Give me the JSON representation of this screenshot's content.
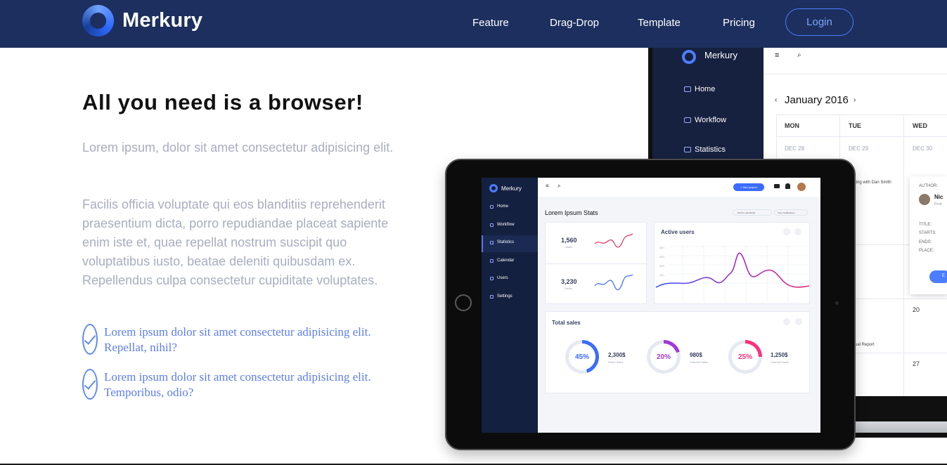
{
  "nav": {
    "brand": "Merkury",
    "links": [
      "Feature",
      "Drag-Drop",
      "Template",
      "Pricing"
    ],
    "login": "Login"
  },
  "hero": {
    "title": "All you need is a browser!",
    "p1": "Lorem ipsum, dolor sit amet consectetur adipisicing elit.",
    "p2": "Facilis officia voluptate qui eos blanditiis reprehenderit praesentium dicta, porro repudiandae placeat sapiente enim iste et, quae repellat nostrum suscipit quo voluptatibus iusto, beatae deleniti quibusdam ex. Repellendus culpa consectetur cupiditate voluptates.",
    "checks": [
      "Lorem ipsum dolor sit amet consectetur adipisicing elit. Repellat, nihil?",
      "Lorem ipsum dolor sit amet consectetur adipisicing elit. Temporibus, odio?"
    ]
  },
  "laptop": {
    "brand": "Merkury",
    "menu": [
      "Home",
      "Workflow",
      "Statistics"
    ],
    "month": "January 2016",
    "days": [
      "MON",
      "TUE",
      "WED"
    ],
    "dates": [
      "DEC 28",
      "DEC 29",
      "DEC 30"
    ],
    "event1": "ting with Dan Smith",
    "event2": "ual Report",
    "num1": "20",
    "num2": "27",
    "popup": {
      "author_label": "AUTHOR:",
      "author_name": "Nic",
      "author_role": "Prod",
      "title_label": "TITLE:",
      "starts_label": "STARTS:",
      "ends_label": "ENDS:",
      "place_label": "PLACE:",
      "button": "E"
    }
  },
  "tablet": {
    "brand": "Merkury",
    "menu": [
      "Home",
      "Workflow",
      "Statistics",
      "Calendar",
      "Users",
      "Settings"
    ],
    "add_project": "+ Add project",
    "heading": "Lorem Ipsum Stats",
    "filter1": "Period: Last Month",
    "filter2": "Type: Notifications",
    "stat1_value": "1,560",
    "stat1_label": "Sales",
    "stat2_value": "3,230",
    "stat2_label": "Views",
    "active_users_title": "Active users",
    "total_sales_title": "Total sales",
    "rings": [
      {
        "percent": "45%",
        "amount": "2,300$",
        "label": "Direct Sales",
        "color": "#3b6cff"
      },
      {
        "percent": "20%",
        "amount": "980$",
        "label": "Channel Sales",
        "color": "#a13ad6"
      },
      {
        "percent": "25%",
        "amount": "1,250$",
        "label": "Channel Sales",
        "color": "#ff2f7d"
      }
    ],
    "y_ticks": [
      "500",
      "400",
      "300",
      "200",
      "100"
    ]
  },
  "colors": {
    "nav_bg": "#1c2f5e",
    "accent": "#4c7dff",
    "check_text": "#5d7df0",
    "muted_text": "#a7aec0"
  }
}
